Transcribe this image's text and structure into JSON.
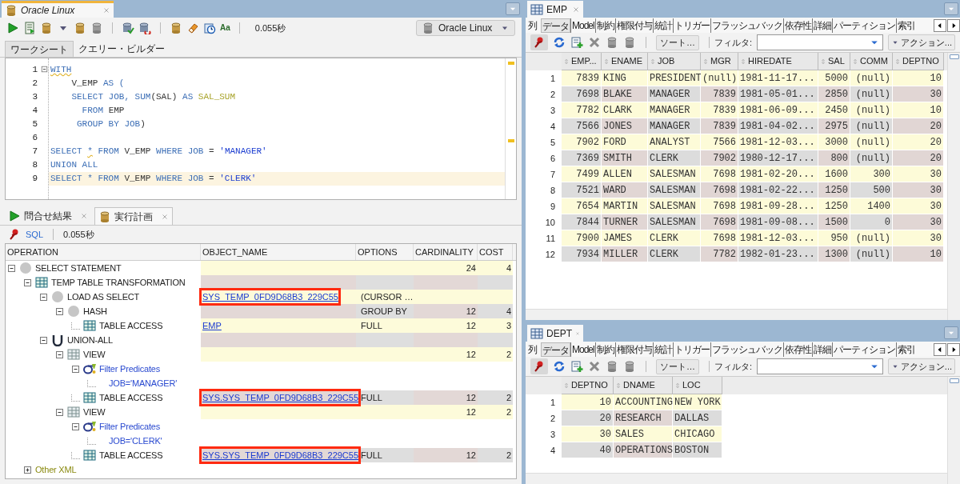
{
  "worksheet": {
    "tab_title": "Oracle Linux",
    "format_glyph": "Aa",
    "elapsed": "0.055秒",
    "connection": "Oracle Linux",
    "subtabs": [
      {
        "label": "ワークシート",
        "selected": true
      },
      {
        "label": "クエリー・ビルダー",
        "selected": false
      }
    ],
    "code_lines": [
      {
        "number": "1",
        "current": false,
        "segments": [
          {
            "kind": "warning",
            "text": "WITH"
          }
        ]
      },
      {
        "number": "2",
        "current": false,
        "segments": [
          {
            "kind": "ident",
            "text": "    V_EMP "
          },
          {
            "kind": "keyword",
            "text": "AS ("
          }
        ]
      },
      {
        "number": "3",
        "current": false,
        "segments": [
          {
            "kind": "keyword",
            "text": "    SELECT JOB, SUM"
          },
          {
            "kind": "ident",
            "text": "(SAL) "
          },
          {
            "kind": "keyword",
            "text": "AS "
          },
          {
            "kind": "alias",
            "text": "SAL_SUM"
          }
        ]
      },
      {
        "number": "4",
        "current": false,
        "segments": [
          {
            "kind": "keyword",
            "text": "      FROM "
          },
          {
            "kind": "ident",
            "text": "EMP"
          }
        ]
      },
      {
        "number": "5",
        "current": false,
        "segments": [
          {
            "kind": "keyword",
            "text": "     GROUP BY JOB"
          },
          {
            "kind": "ident",
            "text": ")"
          }
        ]
      },
      {
        "number": "6",
        "current": false
      },
      {
        "number": "7",
        "current": false,
        "segments": [
          {
            "kind": "keyword",
            "text": "SELECT "
          },
          {
            "kind": "warning",
            "text": "*"
          },
          {
            "kind": "keyword",
            "text": " FROM "
          },
          {
            "kind": "ident",
            "text": "V_EMP "
          },
          {
            "kind": "keyword",
            "text": "WHERE JOB"
          },
          {
            "kind": "ident",
            "text": " = "
          },
          {
            "kind": "string",
            "text": "'MANAGER'"
          }
        ]
      },
      {
        "number": "8",
        "current": false,
        "segments": [
          {
            "kind": "keyword",
            "text": "UNION ALL"
          }
        ]
      },
      {
        "number": "9",
        "current": true,
        "segments": [
          {
            "kind": "keyword",
            "text": "SELECT * FROM "
          },
          {
            "kind": "ident",
            "text": "V_EMP "
          },
          {
            "kind": "keyword",
            "text": "WHERE JOB"
          },
          {
            "kind": "ident",
            "text": " = "
          },
          {
            "kind": "string",
            "text": "'CLERK'"
          }
        ]
      }
    ]
  },
  "results": {
    "tabs": [
      {
        "label": "問合せ結果",
        "kind": "results",
        "selected": false
      },
      {
        "label": "実行計画",
        "kind": "plan",
        "selected": true
      }
    ],
    "sql_link": "SQL",
    "elapsed": "0.055秒",
    "plan": {
      "columns": [
        "OPERATION",
        "OBJECT_NAME",
        "OPTIONS",
        "CARDINALITY",
        "COST"
      ],
      "rows": [
        {
          "kind": "circle",
          "operation": "SELECT STATEMENT",
          "cardinality": "24",
          "cost": "4",
          "expanded": true,
          "children": [
            {
              "kind": "table",
              "operation": "TEMP TABLE TRANSFORMATION",
              "expanded": true,
              "children": [
                {
                  "kind": "circle",
                  "operation": "LOAD AS SELECT",
                  "object_name": "SYS_TEMP_0FD9D68B3_229C55",
                  "options": "(CURSOR …",
                  "highlighted": true,
                  "expanded": true,
                  "children": [
                    {
                      "kind": "circle",
                      "operation": "HASH",
                      "options": "GROUP BY",
                      "cardinality": "12",
                      "cost": "4",
                      "expanded": true,
                      "children": [
                        {
                          "kind": "table",
                          "operation": "TABLE ACCESS",
                          "object_name": "EMP",
                          "options": "FULL",
                          "cardinality": "12",
                          "cost": "3",
                          "highlighted": false
                        }
                      ]
                    }
                  ]
                },
                {
                  "kind": "union",
                  "operation": "UNION-ALL",
                  "expanded": true,
                  "children": [
                    {
                      "kind": "view",
                      "operation": "VIEW",
                      "cardinality": "12",
                      "cost": "2",
                      "expanded": true,
                      "children": [
                        {
                          "kind": "filter",
                          "operation": "Filter Predicates",
                          "expanded": true,
                          "children": [
                            {
                              "kind": "predicate",
                              "operation": "JOB='MANAGER'"
                            }
                          ]
                        },
                        {
                          "kind": "table",
                          "operation": "TABLE ACCESS",
                          "object_name": "SYS.SYS_TEMP_0FD9D68B3_229C55",
                          "options": "FULL",
                          "cardinality": "12",
                          "cost": "2",
                          "highlighted": true
                        }
                      ]
                    },
                    {
                      "kind": "view",
                      "operation": "VIEW",
                      "cardinality": "12",
                      "cost": "2",
                      "expanded": true,
                      "children": [
                        {
                          "kind": "filter",
                          "operation": "Filter Predicates",
                          "expanded": true,
                          "children": [
                            {
                              "kind": "predicate",
                              "operation": "JOB='CLERK'"
                            }
                          ]
                        },
                        {
                          "kind": "table",
                          "operation": "TABLE ACCESS",
                          "object_name": "SYS.SYS_TEMP_0FD9D68B3_229C55",
                          "options": "FULL",
                          "cardinality": "12",
                          "cost": "2",
                          "highlighted": true
                        }
                      ]
                    }
                  ]
                }
              ]
            },
            {
              "kind": "xml",
              "operation": "Other XML",
              "expanded": false
            }
          ]
        }
      ]
    }
  },
  "tables": [
    {
      "tab_title": "EMP",
      "sort": "ソート…",
      "filter_label": "フィルタ:",
      "action": "アクション...",
      "subtabs": [
        {
          "label": "列",
          "selected": false
        },
        {
          "label": "データ",
          "selected": true
        },
        {
          "label": "Model",
          "selected": false
        },
        {
          "label": "制約",
          "selected": false
        },
        {
          "label": "権限付与",
          "selected": false
        },
        {
          "label": "統計",
          "selected": false
        },
        {
          "label": "トリガー",
          "selected": false
        },
        {
          "label": "フラッシュバック",
          "selected": false
        },
        {
          "label": "依存性",
          "selected": false
        },
        {
          "label": "詳細",
          "selected": false
        },
        {
          "label": "パーティション",
          "selected": false
        },
        {
          "label": "索引",
          "selected": false
        }
      ],
      "columns": [
        {
          "label": "EMP...",
          "numeric": true
        },
        {
          "label": "ENAME",
          "numeric": false
        },
        {
          "label": "JOB",
          "numeric": false
        },
        {
          "label": "MGR",
          "numeric": true
        },
        {
          "label": "HIREDATE",
          "numeric": false
        },
        {
          "label": "SAL",
          "numeric": true
        },
        {
          "label": "COMM",
          "numeric": true
        },
        {
          "label": "DEPTNO",
          "numeric": true
        }
      ],
      "rows": [
        {
          "number": "1",
          "cells": [
            "7839",
            "KING",
            "PRESIDENT",
            "(null)",
            "1981-11-17...",
            "5000",
            "(null)",
            "10"
          ]
        },
        {
          "number": "2",
          "cells": [
            "7698",
            "BLAKE",
            "MANAGER",
            "7839",
            "1981-05-01...",
            "2850",
            "(null)",
            "30"
          ]
        },
        {
          "number": "3",
          "cells": [
            "7782",
            "CLARK",
            "MANAGER",
            "7839",
            "1981-06-09...",
            "2450",
            "(null)",
            "10"
          ]
        },
        {
          "number": "4",
          "cells": [
            "7566",
            "JONES",
            "MANAGER",
            "7839",
            "1981-04-02...",
            "2975",
            "(null)",
            "20"
          ]
        },
        {
          "number": "5",
          "cells": [
            "7902",
            "FORD",
            "ANALYST",
            "7566",
            "1981-12-03...",
            "3000",
            "(null)",
            "20"
          ]
        },
        {
          "number": "6",
          "cells": [
            "7369",
            "SMITH",
            "CLERK",
            "7902",
            "1980-12-17...",
            "800",
            "(null)",
            "20"
          ]
        },
        {
          "number": "7",
          "cells": [
            "7499",
            "ALLEN",
            "SALESMAN",
            "7698",
            "1981-02-20...",
            "1600",
            "300",
            "30"
          ]
        },
        {
          "number": "8",
          "cells": [
            "7521",
            "WARD",
            "SALESMAN",
            "7698",
            "1981-02-22...",
            "1250",
            "500",
            "30"
          ]
        },
        {
          "number": "9",
          "cells": [
            "7654",
            "MARTIN",
            "SALESMAN",
            "7698",
            "1981-09-28...",
            "1250",
            "1400",
            "30"
          ]
        },
        {
          "number": "10",
          "cells": [
            "7844",
            "TURNER",
            "SALESMAN",
            "7698",
            "1981-09-08...",
            "1500",
            "0",
            "30"
          ]
        },
        {
          "number": "11",
          "cells": [
            "7900",
            "JAMES",
            "CLERK",
            "7698",
            "1981-12-03...",
            "950",
            "(null)",
            "30"
          ]
        },
        {
          "number": "12",
          "cells": [
            "7934",
            "MILLER",
            "CLERK",
            "7782",
            "1982-01-23...",
            "1300",
            "(null)",
            "10"
          ]
        }
      ]
    },
    {
      "tab_title": "DEPT",
      "sort": "ソート…",
      "filter_label": "フィルタ:",
      "action": "アクション...",
      "subtabs": [
        {
          "label": "列",
          "selected": false
        },
        {
          "label": "データ",
          "selected": true
        },
        {
          "label": "Model",
          "selected": false
        },
        {
          "label": "制約",
          "selected": false
        },
        {
          "label": "権限付与",
          "selected": false
        },
        {
          "label": "統計",
          "selected": false
        },
        {
          "label": "トリガー",
          "selected": false
        },
        {
          "label": "フラッシュバック",
          "selected": false
        },
        {
          "label": "依存性",
          "selected": false
        },
        {
          "label": "詳細",
          "selected": false
        },
        {
          "label": "パーティション",
          "selected": false
        },
        {
          "label": "索引",
          "selected": false
        }
      ],
      "columns": [
        {
          "label": "DEPTNO",
          "numeric": true
        },
        {
          "label": "DNAME",
          "numeric": false
        },
        {
          "label": "LOC",
          "numeric": false
        }
      ],
      "rows": [
        {
          "number": "1",
          "cells": [
            "10",
            "ACCOUNTING",
            "NEW YORK"
          ]
        },
        {
          "number": "2",
          "cells": [
            "20",
            "RESEARCH",
            "DALLAS"
          ]
        },
        {
          "number": "3",
          "cells": [
            "30",
            "SALES",
            "CHICAGO"
          ]
        },
        {
          "number": "4",
          "cells": [
            "40",
            "OPERATIONS",
            "BOSTON"
          ]
        }
      ]
    }
  ]
}
